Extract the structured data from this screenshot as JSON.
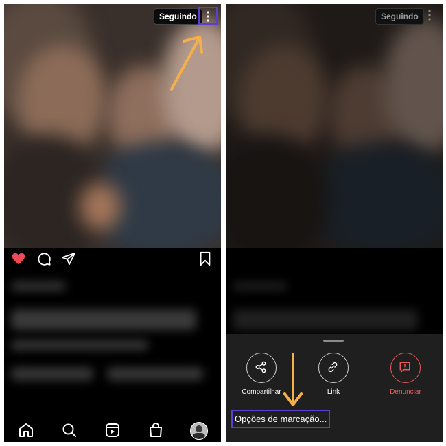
{
  "left_panel": {
    "follow_label": "Seguindo",
    "action_icons": [
      "heart-icon",
      "comment-icon",
      "share-icon",
      "bookmark-icon"
    ],
    "nav_icons": [
      "home-icon",
      "search-icon",
      "reels-icon",
      "shop-icon",
      "profile-icon"
    ],
    "colors": {
      "like": "#ed4956",
      "highlight": "#5b3fd0",
      "arrow": "#f6b04a"
    }
  },
  "right_panel": {
    "follow_label": "Seguindo",
    "sheet": {
      "actions": [
        {
          "label": "Compartilhar",
          "icon": "share-icon"
        },
        {
          "label": "Link",
          "icon": "link-icon"
        },
        {
          "label": "Denunciar",
          "icon": "report-icon"
        }
      ],
      "tag_options_label": "Opções de marcação..."
    },
    "colors": {
      "report": "#e45a5a"
    }
  }
}
